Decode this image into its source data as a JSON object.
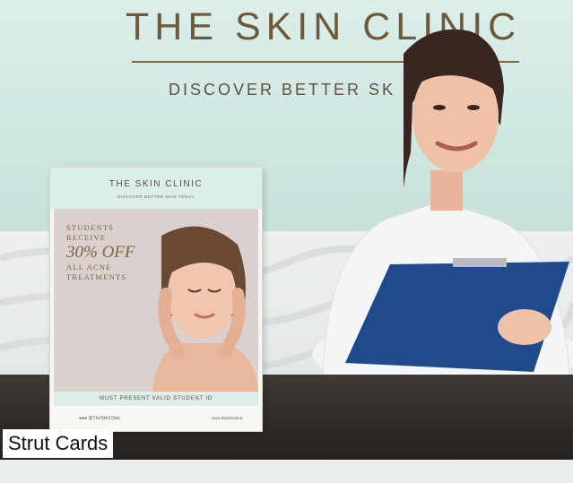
{
  "wall_sign": {
    "title": "THE SKIN CLINIC",
    "tagline": "DISCOVER BETTER SK"
  },
  "strut_card": {
    "title": "THE SKIN CLINIC",
    "tagline": "DISCOVER BETTER SKIN TODAY",
    "offer": {
      "line1": "STUDENTS",
      "line2": "RECEIVE",
      "line3": "30% OFF",
      "line4": "ALL ACNE",
      "line5": "TREATMENTS"
    },
    "footer": "MUST PRESENT VALID STUDENT ID",
    "social": "@TheSkinClinic",
    "website": "www.theskinclinic"
  },
  "caption": "Strut Cards",
  "colors": {
    "wall": "#cfe6e1",
    "gold_text": "#6d5a3a",
    "desk": "#2f2a28",
    "clipboard": "#1f4a8c"
  }
}
